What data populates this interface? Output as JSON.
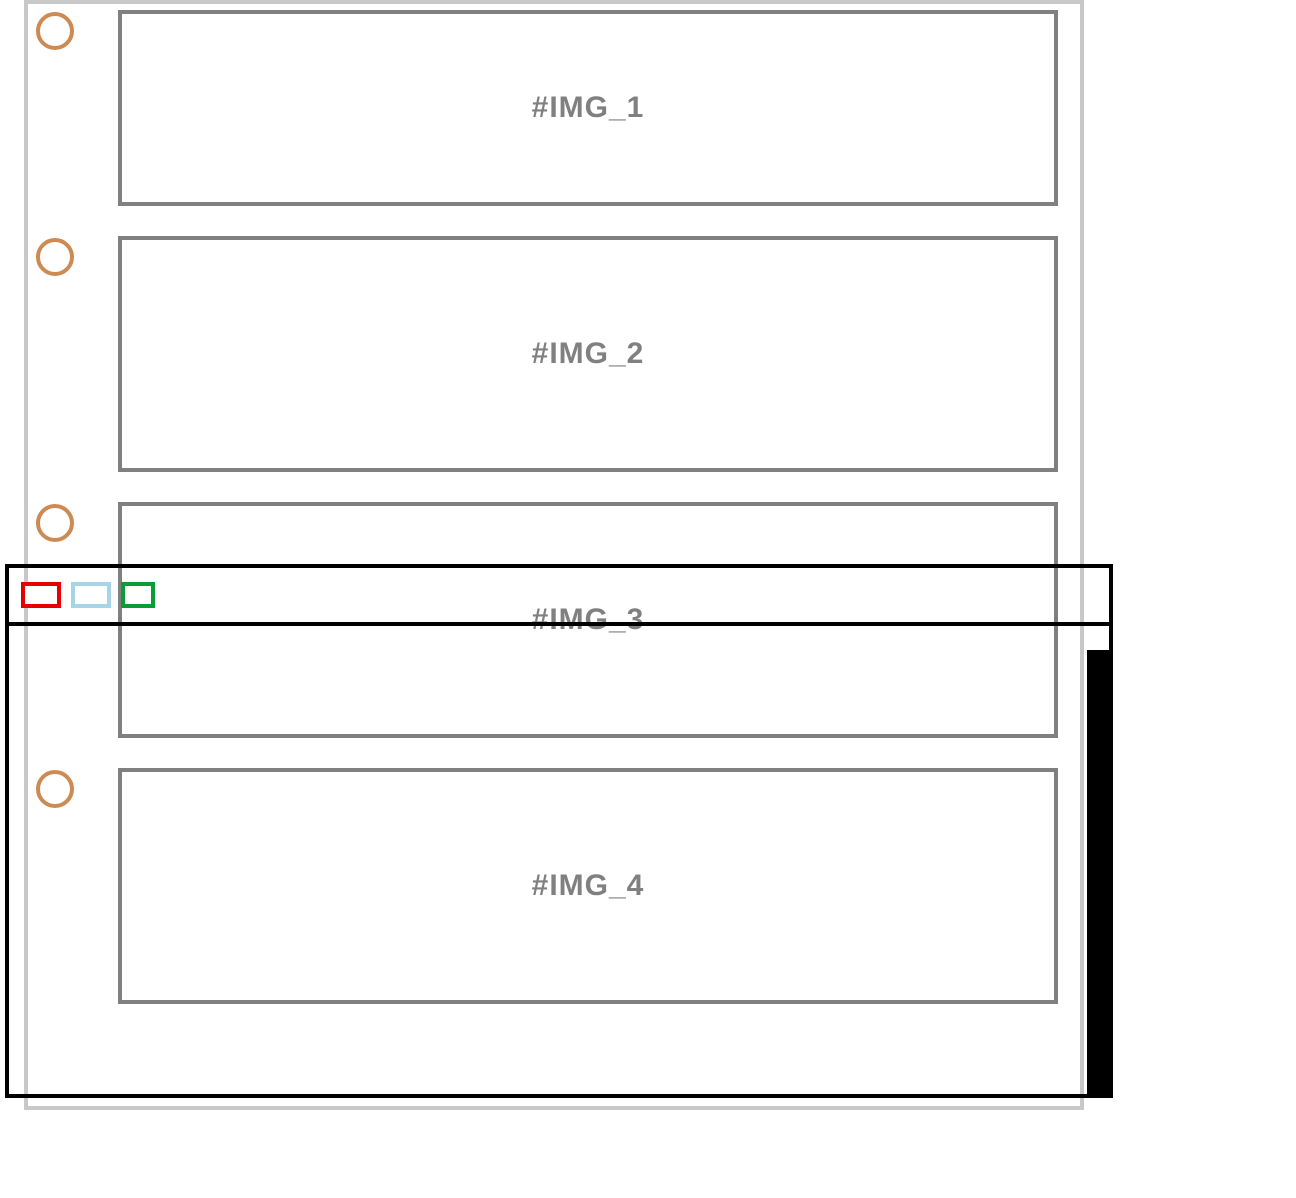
{
  "slots": [
    {
      "label": "#IMG_1"
    },
    {
      "label": "#IMG_2"
    },
    {
      "label": "#IMG_3"
    },
    {
      "label": "#IMG_4"
    }
  ],
  "window": {
    "buttons": {
      "close_color": "#e60000",
      "min_color": "#a6d5e8",
      "zoom_color": "#0b9c33"
    }
  }
}
